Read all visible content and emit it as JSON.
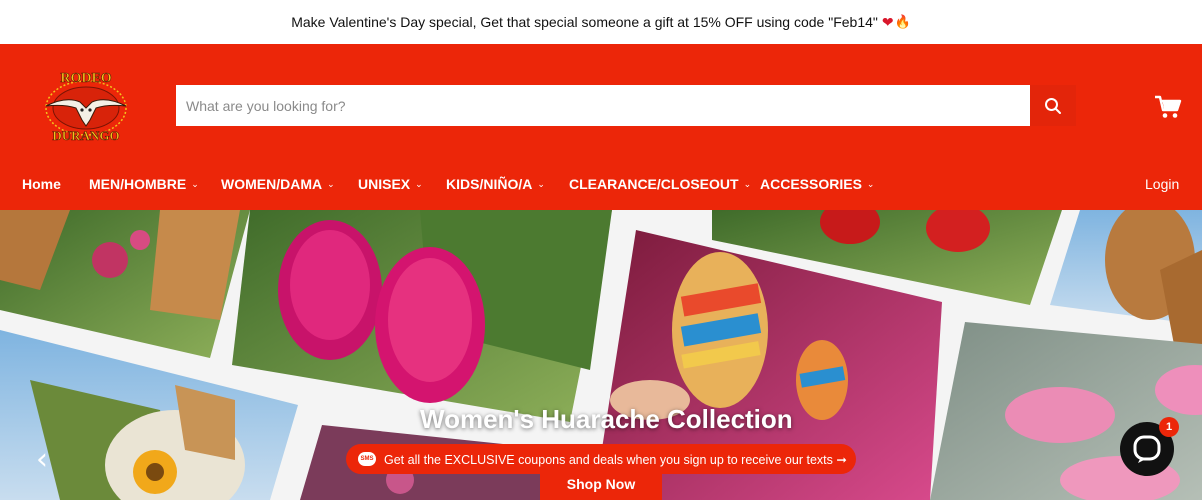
{
  "announcement": {
    "text": "Make Valentine's Day special, Get that special someone a gift at 15% OFF using code \"Feb14\"",
    "emoji_heart": "❤",
    "emoji_fire": "🔥"
  },
  "header": {
    "logo_top": "RODEO",
    "logo_bottom": "DURANGO",
    "search_placeholder": "What are you looking for?",
    "brand_color": "#ec2609"
  },
  "nav": {
    "items": [
      {
        "label": "Home",
        "has_dropdown": false
      },
      {
        "label": "MEN/HOMBRE",
        "has_dropdown": true
      },
      {
        "label": "WOMEN/DAMA",
        "has_dropdown": true
      },
      {
        "label": "UNISEX",
        "has_dropdown": true
      },
      {
        "label": "KIDS/NIÑO/A",
        "has_dropdown": true
      },
      {
        "label": "CLEARANCE/CLOSEOUT",
        "has_dropdown": true
      },
      {
        "label": "ACCESSORIES",
        "has_dropdown": true
      }
    ],
    "login": "Login",
    "chevron": "⌄"
  },
  "hero": {
    "title": "Women's Huarache Collection",
    "prev_arrow": "‹",
    "sms_icon": "SMS",
    "sms_text": "Get all the EXCLUSIVE coupons and deals when you sign up to receive our texts ➞",
    "cta": "Shop Now"
  },
  "chat": {
    "badge": "1"
  }
}
